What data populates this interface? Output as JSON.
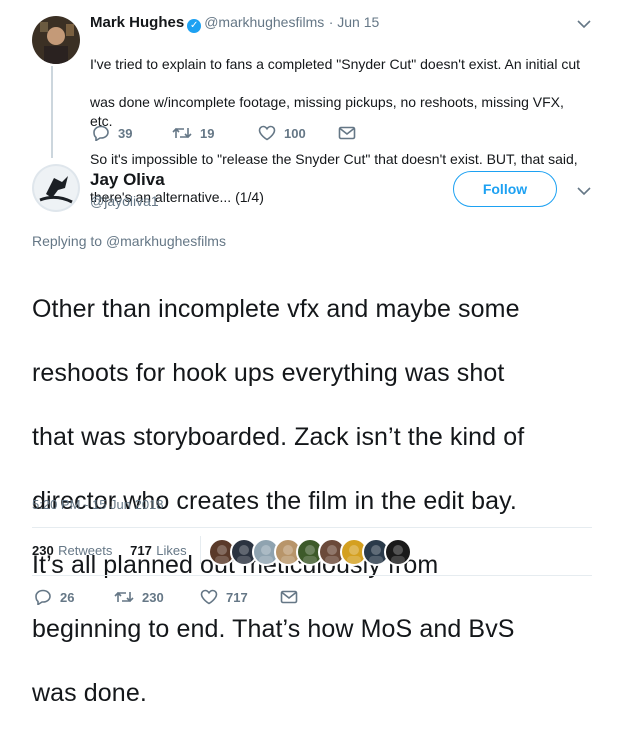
{
  "parent_tweet": {
    "name": "Mark Hughes",
    "handle": "@markhughesfilms",
    "date": "· Jun 15",
    "lines": [
      "I've tried to explain to fans a completed \"Snyder Cut\" doesn't exist. An initial cut",
      "was done w/incomplete footage, missing pickups, no reshoots, missing VFX, etc.",
      "So it's impossible to \"release the Snyder Cut\" that doesn't exist. BUT, that said,",
      "there's an alternative... (1/4)"
    ],
    "replies": "39",
    "retweets": "19",
    "likes": "100"
  },
  "tweet": {
    "name": "Jay Oliva",
    "handle": "@jayoliva1",
    "follow_label": "Follow",
    "replying_prefix": "Replying to",
    "replying_to": "@markhughesfilms",
    "text_lines": [
      "Other than incomplete vfx and maybe some",
      "reshoots for hook ups everything was shot",
      "that was storyboarded. Zack isn’t the kind of",
      "director who creates the film in the edit bay.",
      "It’s all planned out meticulously from",
      "beginning to end. That’s how MoS and BvS",
      "was done."
    ],
    "timestamp": "5:20 PM - 15 Jun 2018",
    "stats": {
      "retweets_count": "230",
      "retweets_label": "Retweets",
      "likes_count": "717",
      "likes_label": "Likes"
    },
    "likers": [
      "#5a3a2a",
      "#2b3340",
      "#8fa3b0",
      "#b8956a",
      "#3d5a2a",
      "#6b4a3a",
      "#d4a020",
      "#2a3a4a",
      "#1a1a1a"
    ],
    "actions": {
      "replies": "26",
      "retweets": "230",
      "likes": "717"
    }
  },
  "colors": {
    "accent": "#1da1f2",
    "muted": "#657786",
    "divider": "#e6ecf0"
  }
}
